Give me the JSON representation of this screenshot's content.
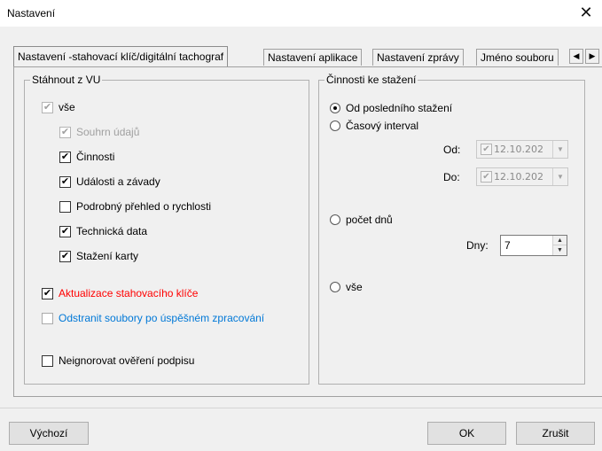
{
  "window": {
    "title": "Nastavení",
    "close_glyph": "✕"
  },
  "tabs": [
    {
      "label": "Nastavení -stahovací klíč/digitální tachograf",
      "active": true
    },
    {
      "label": "Nastavení aplikace",
      "active": false
    },
    {
      "label": "Nastavení zprávy",
      "active": false
    },
    {
      "label": "Jméno souboru",
      "active": false
    }
  ],
  "tab_scroll": {
    "left_icon": "◀",
    "right_icon": "▶"
  },
  "left_group": {
    "title": "Stáhnout z VU",
    "items": [
      {
        "label": "vše",
        "checked": true,
        "enabled": false
      },
      {
        "label": "Souhrn údajů",
        "checked": true,
        "enabled": false
      },
      {
        "label": "Činnosti",
        "checked": true,
        "enabled": true
      },
      {
        "label": "Události a závady",
        "checked": true,
        "enabled": true
      },
      {
        "label": "Podrobný přehled o rychlosti",
        "checked": false,
        "enabled": true
      },
      {
        "label": "Technická data",
        "checked": true,
        "enabled": true
      },
      {
        "label": "Stažení karty",
        "checked": true,
        "enabled": true
      }
    ],
    "update_key": {
      "label": "Aktualizace stahovacího klíče",
      "checked": true,
      "color": "#ff0000"
    },
    "remove_files": {
      "label": "Odstranit soubory po úspěšném zpracování",
      "checked": false,
      "color": "#0078d7"
    },
    "ignore_signature": {
      "label": "Neignorovat ověření podpisu",
      "checked": false
    }
  },
  "right_group": {
    "title": "Činnosti ke stažení",
    "options": {
      "since_last": "Od posledního stažení",
      "time_interval": "Časový interval",
      "day_count": "počet dnů",
      "all": "vše"
    },
    "selected": "since_last",
    "from_label": "Od:",
    "from_value": "12.10.202",
    "to_label": "Do:",
    "to_value": "12.10.202",
    "days_label": "Dny:",
    "days_value": "7"
  },
  "buttons": {
    "defaults": "Výchozí",
    "ok": "OK",
    "cancel": "Zrušit"
  },
  "check_glyph": "✔",
  "dropdown_glyph": "▼",
  "spin_up": "▲",
  "spin_down": "▼"
}
